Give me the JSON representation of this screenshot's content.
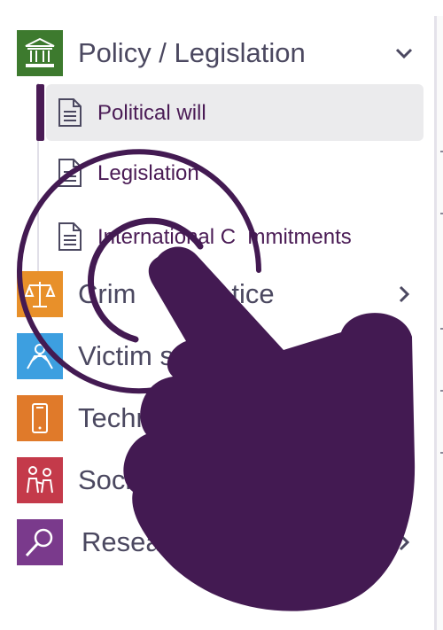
{
  "menu": {
    "sections": [
      {
        "label": "Policy / Legislation",
        "icon": "courthouse-icon",
        "color": "#3d7a2e",
        "expanded": true
      },
      {
        "label": "Crim",
        "extra": "tice",
        "icon": "scales-icon",
        "color": "#e8902a"
      },
      {
        "label": "Victim su",
        "icon": "victim-support-icon",
        "color": "#3d9fe0"
      },
      {
        "label": "Techn",
        "icon": "phone-icon",
        "color": "#e07a2a"
      },
      {
        "label": "Socie",
        "icon": "people-icon",
        "color": "#c43a4a"
      },
      {
        "label": "Resea",
        "icon": "magnifier-icon",
        "color": "#7a3a8c"
      }
    ],
    "subitems": [
      {
        "label": "Political will",
        "active": true
      },
      {
        "label": "Legislatio",
        "extra": "n"
      },
      {
        "label": "International C",
        "extra": "mmitments"
      }
    ]
  },
  "colors": {
    "accent": "#4a1b55",
    "text": "#4b4860",
    "active_bg": "#ebebed"
  }
}
